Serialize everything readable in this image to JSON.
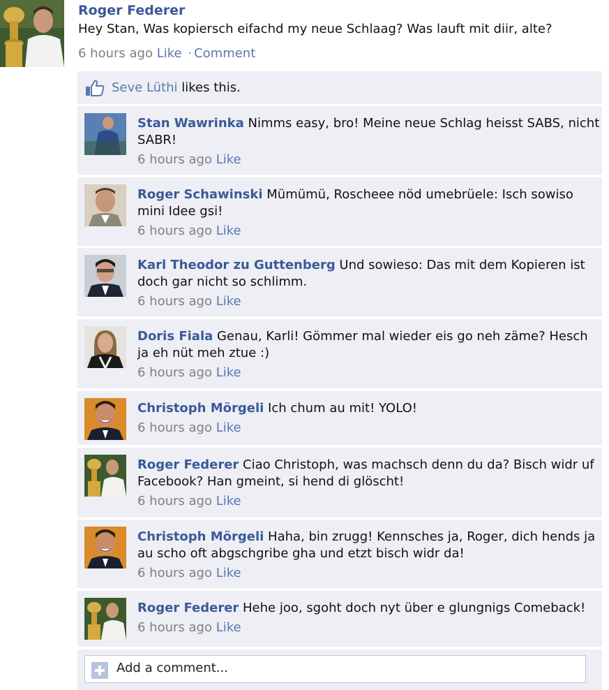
{
  "post": {
    "author": "Roger Federer",
    "text": "Hey Stan, Was kopiersch eifachd my neue Schlaag? Was lauft mit diir, alte?",
    "time": "6 hours ago",
    "like_label": "Like",
    "separator": "·",
    "comment_label": "Comment"
  },
  "likes": {
    "liker": "Seve Lüthi",
    "suffix": " likes this."
  },
  "comments": [
    {
      "name": "Stan Wawrinka",
      "text": " Nimms easy, bro! Meine neue Schlag heisst SABS, nicht SABR!",
      "time": "6 hours ago",
      "like": "Like"
    },
    {
      "name": "Roger Schawinski",
      "text": " Mümümü, Roscheee nöd umebrüele: Isch sowiso mini Idee gsi!",
      "time": "6 hours ago",
      "like": "Like"
    },
    {
      "name": "Karl Theodor zu Guttenberg",
      "text": " Und sowieso: Das mit dem Kopieren ist doch gar nicht so schlimm.",
      "time": "6 hours ago",
      "like": "Like"
    },
    {
      "name": "Doris Fiala",
      "text": " Genau, Karli! Gömmer mal wieder eis go neh zäme? Hesch ja eh nüt meh ztue :)",
      "time": "6 hours ago",
      "like": "Like"
    },
    {
      "name": "Christoph Mörgeli",
      "text": " Ich chum au mit! YOLO!",
      "time": "6 hours ago",
      "like": "Like"
    },
    {
      "name": "Roger Federer",
      "text": " Ciao Christoph, was machsch denn du da? Bisch widr uf Facebook? Han gmeint, si hend di glöscht!",
      "time": "6 hours ago",
      "like": "Like"
    },
    {
      "name": "Christoph Mörgeli",
      "text": " Haha, bin zrugg! Kennsches ja, Roger, dich hends ja au scho oft abgschgribe gha und etzt bisch widr da!",
      "time": "6 hours ago",
      "like": "Like"
    },
    {
      "name": "Roger Federer",
      "text": " Hehe joo, sgoht doch nyt über e glungnigs Comeback!",
      "time": "6 hours ago",
      "like": "Like"
    }
  ],
  "add_comment": {
    "placeholder": "Add a comment..."
  },
  "colors": {
    "link": "#3b5998",
    "panel": "#edeff4",
    "meta": "#808080"
  }
}
